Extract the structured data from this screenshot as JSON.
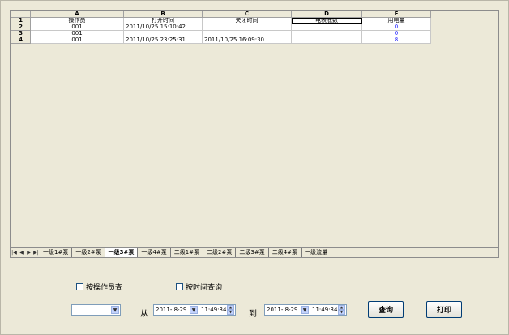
{
  "sheet": {
    "columns": [
      "A",
      "B",
      "C",
      "D",
      "E"
    ],
    "rows": [
      {
        "num": "1",
        "cells": [
          "操作员",
          "打开时间",
          "关闭时间",
          "电表底数",
          "用电量"
        ]
      },
      {
        "num": "2",
        "cells": [
          "001",
          "2011/10/25 15:10:42",
          "",
          "",
          "0"
        ]
      },
      {
        "num": "3",
        "cells": [
          "001",
          "",
          "",
          "",
          "0"
        ]
      },
      {
        "num": "4",
        "cells": [
          "001",
          "2011/10/25 23:25:31",
          "2011/10/25 16:09:30",
          "",
          "8"
        ]
      }
    ],
    "selected_cell": "D1",
    "value_color": "#1a1aff"
  },
  "tabs": [
    "一级1#泵",
    "一级2#泵",
    "一级3#泵",
    "一级4#泵",
    "二级1#泵",
    "二级2#泵",
    "二级3#泵",
    "二级4#泵",
    "一级流量"
  ],
  "active_tab": "一级3#泵",
  "filters": {
    "by_operator_label": "按操作员查",
    "by_time_label": "按时间查询",
    "from_label": "从",
    "to_label": "到",
    "operator_value": "",
    "from_date": "2011- 8-29",
    "from_time": "11:49:34",
    "to_date": "2011- 8-29",
    "to_time": "11:49:34"
  },
  "buttons": {
    "query": "查询",
    "print": "打印"
  }
}
